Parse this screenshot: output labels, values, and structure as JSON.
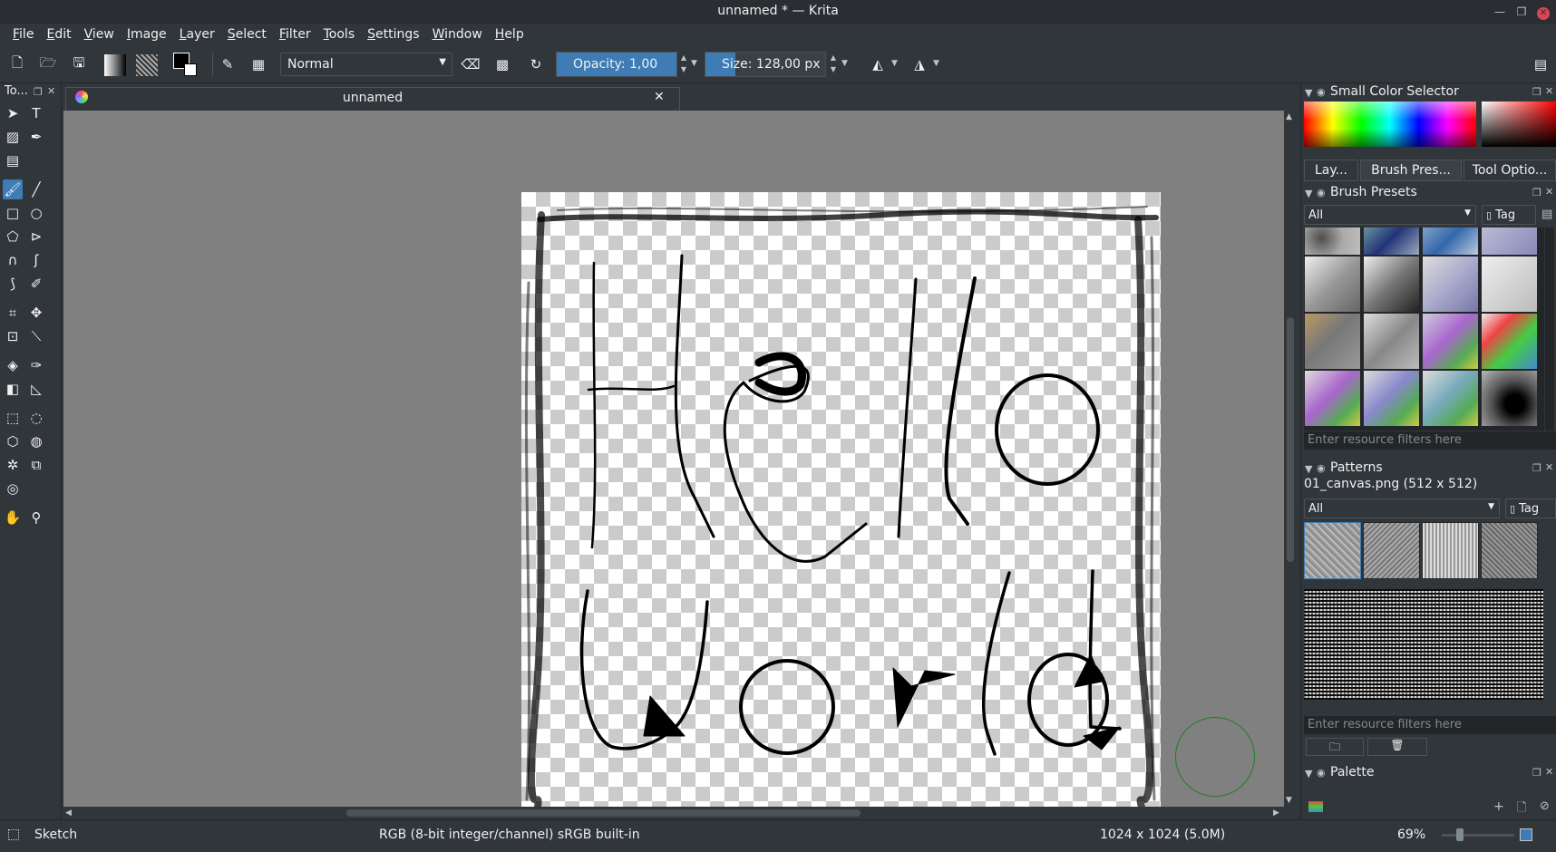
{
  "window": {
    "title": "unnamed * — Krita"
  },
  "menu": [
    "File",
    "Edit",
    "View",
    "Image",
    "Layer",
    "Select",
    "Filter",
    "Tools",
    "Settings",
    "Window",
    "Help"
  ],
  "toolbar": {
    "blend_mode": "Normal",
    "opacity_label": "Opacity:  1,00",
    "opacity_fraction": 1.0,
    "size_label": "Size:  128,00 px",
    "size_fraction": 0.25
  },
  "toolbox": {
    "title": "To..."
  },
  "document": {
    "tab_title": "unnamed"
  },
  "dockers": {
    "color_selector_title": "Small Color Selector",
    "tabs": [
      "Lay...",
      "Brush Pres...",
      "Tool Optio..."
    ],
    "brush_presets": {
      "title": "Brush Presets",
      "tag_filter": "All",
      "tag_button": "Tag",
      "filter_placeholder": "Enter resource filters here"
    },
    "patterns": {
      "title": "Patterns",
      "current": "01_canvas.png (512 x 512)",
      "tag_filter": "All",
      "tag_button": "Tag",
      "filter_placeholder": "Enter resource filters here"
    },
    "palette": {
      "title": "Palette"
    }
  },
  "statusbar": {
    "brush_name": "Sketch",
    "color_profile": "RGB (8-bit integer/channel)  sRGB built-in",
    "image_size": "1024 x 1024 (5.0M)",
    "zoom": "69%"
  },
  "colors": {
    "accent": "#3f7cb5",
    "bg": "#31363b",
    "canvas_bg": "#808080"
  }
}
